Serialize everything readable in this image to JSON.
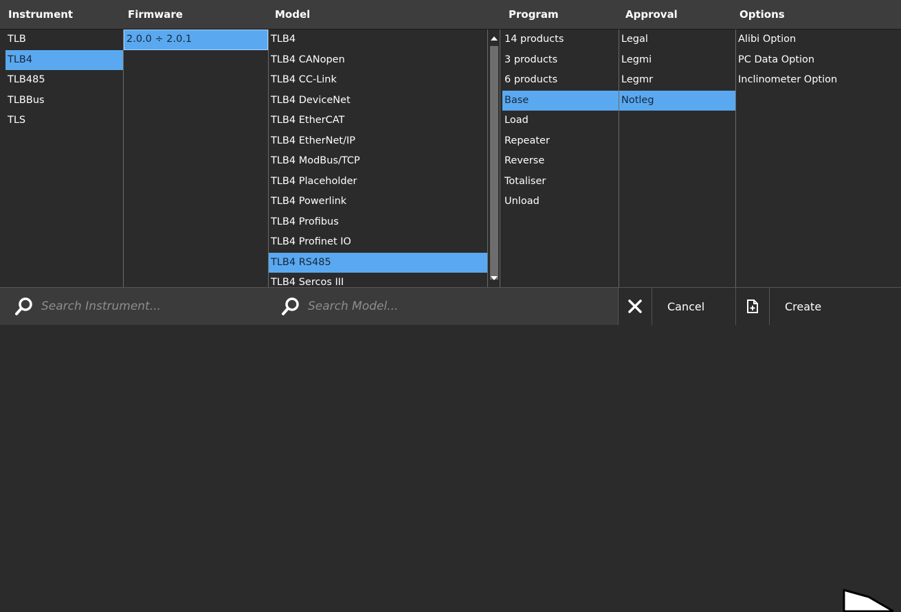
{
  "columns": {
    "instrument": {
      "header": "Instrument",
      "items": [
        "TLB",
        "TLB4",
        "TLB485",
        "TLBBus",
        "TLS"
      ],
      "selected": "TLB4"
    },
    "firmware": {
      "header": "Firmware",
      "items": [
        "2.0.0 ÷ 2.0.1"
      ],
      "selected": "2.0.0 ÷ 2.0.1"
    },
    "model": {
      "header": "Model",
      "items": [
        "TLB4",
        "TLB4 CANopen",
        "TLB4 CC-Link",
        "TLB4 DeviceNet",
        "TLB4 EtherCAT",
        "TLB4 EtherNet/IP",
        "TLB4 ModBus/TCP",
        "TLB4 Placeholder",
        "TLB4 Powerlink",
        "TLB4 Profibus",
        "TLB4 Profinet IO",
        "TLB4 RS485",
        "TLB4 Sercos III"
      ],
      "selected": "TLB4 RS485"
    },
    "program": {
      "header": "Program",
      "items": [
        "14 products",
        "3 products",
        "6 products",
        "Base",
        "Load",
        "Repeater",
        "Reverse",
        "Totaliser",
        "Unload"
      ],
      "selected": "Base"
    },
    "approval": {
      "header": "Approval",
      "items": [
        "Legal",
        "Legmi",
        "Legmr",
        "Notleg"
      ],
      "selected": "Notleg"
    },
    "options": {
      "header": "Options",
      "items": [
        "Alibi Option",
        "PC Data Option",
        "Inclinometer Option"
      ]
    }
  },
  "search": {
    "instrument_placeholder": "Search Instrument...",
    "model_placeholder": "Search Model..."
  },
  "buttons": {
    "cancel_label": "Cancel",
    "create_label": "Create"
  },
  "colors": {
    "selection": "#5aa9f0",
    "background": "#2b2b2b",
    "header": "#3d3d3d"
  },
  "icons": {
    "search": "magnifier-icon",
    "cancel": "close-icon",
    "create": "new-document-icon",
    "cursor": "mouse-pointer-icon"
  }
}
